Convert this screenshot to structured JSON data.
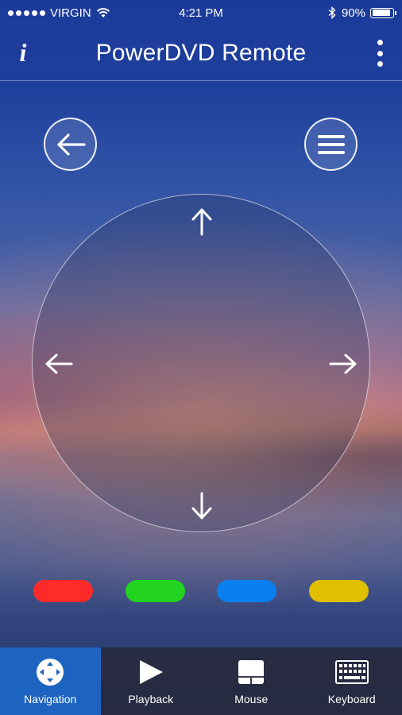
{
  "status_bar": {
    "carrier": "VIRGIN",
    "time": "4:21 PM",
    "battery": "90%",
    "battery_level": 0.9,
    "icons": [
      "signal-dots-icon",
      "wifi-icon",
      "bluetooth-icon",
      "battery-icon"
    ]
  },
  "header": {
    "info_label": "i",
    "title": "PowerDVD Remote"
  },
  "controls": {
    "back_icon": "back-arrow-icon",
    "menu_icon": "menu-icon",
    "dpad_icons": [
      "arrow-up-icon",
      "arrow-down-icon",
      "arrow-left-icon",
      "arrow-right-icon"
    ]
  },
  "color_buttons": [
    {
      "name": "red",
      "color": "#ff2a2a"
    },
    {
      "name": "green",
      "color": "#22d31f"
    },
    {
      "name": "blue",
      "color": "#0a80f0"
    },
    {
      "name": "yellow",
      "color": "#e0bf00"
    }
  ],
  "tabs": [
    {
      "label": "Navigation",
      "icon": "navigation-icon",
      "active": true
    },
    {
      "label": "Playback",
      "icon": "play-icon",
      "active": false
    },
    {
      "label": "Mouse",
      "icon": "mouse-icon",
      "active": false
    },
    {
      "label": "Keyboard",
      "icon": "keyboard-icon",
      "active": false
    }
  ],
  "colors": {
    "active_tab": "#1c64c0",
    "tab_bar": "#282a3e"
  }
}
